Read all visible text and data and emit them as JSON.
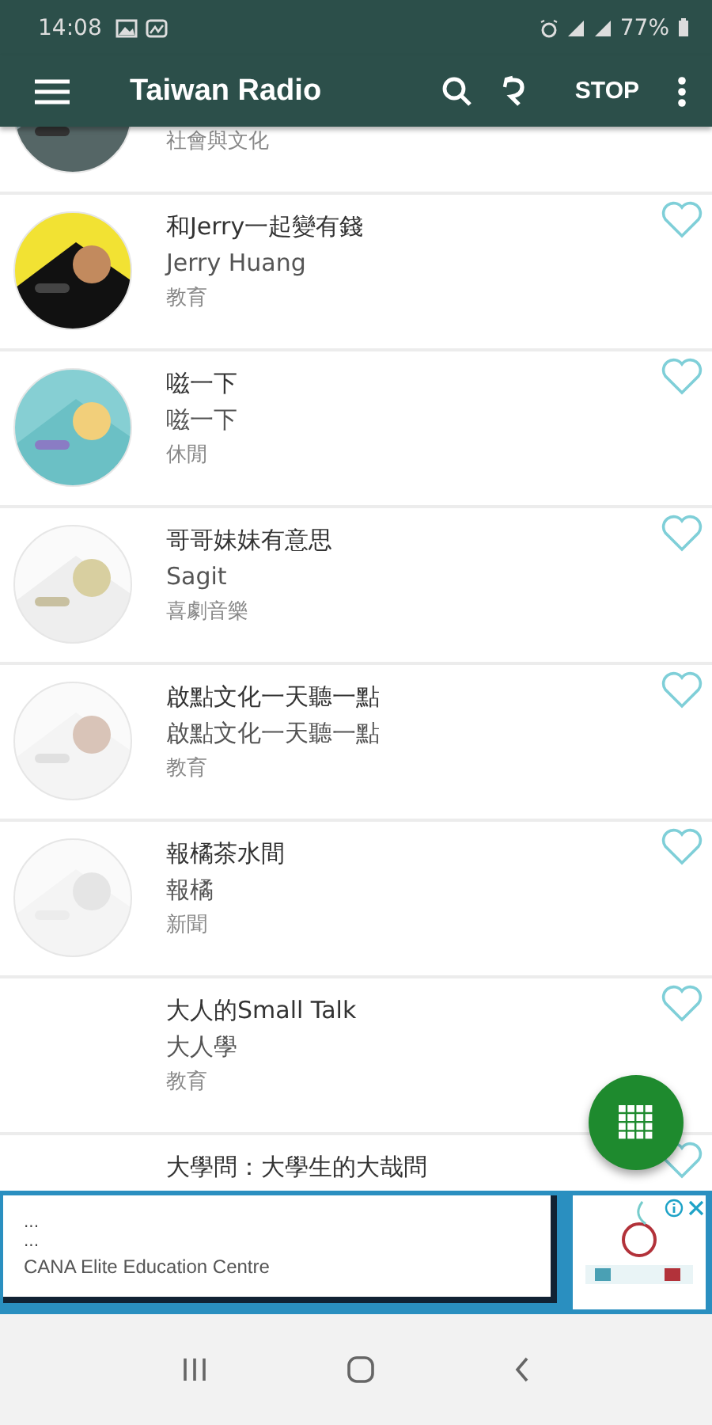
{
  "status_bar": {
    "time": "14:08",
    "battery": "77%"
  },
  "app_bar": {
    "title": "Taiwan Radio",
    "stop": "STOP"
  },
  "stations": [
    {
      "category": "社會與文化",
      "has_picture": true
    },
    {
      "title": "和Jerry一起變有錢",
      "author": "Jerry Huang",
      "category": "教育",
      "has_picture": true
    },
    {
      "title": "嗞一下",
      "author": "嗞一下",
      "category": "休閒",
      "has_picture": true
    },
    {
      "title": "哥哥妹妹有意思",
      "author": "Sagit",
      "category": "喜劇音樂",
      "has_picture": true
    },
    {
      "title": "啟點文化一天聽一點",
      "author": "啟點文化一天聽一點",
      "category": "教育",
      "has_picture": true
    },
    {
      "title": "報橘茶水間",
      "author": "報橘",
      "category": "新聞",
      "has_picture": true
    },
    {
      "title": "大人的Small Talk",
      "author": "大人學",
      "category": "教育",
      "has_picture": false
    },
    {
      "title": "大學問：大學生的大哉問",
      "has_picture": false
    }
  ],
  "ad": {
    "line_1": "...",
    "line_2": "...",
    "advertiser": "CANA Elite Education Centre"
  }
}
